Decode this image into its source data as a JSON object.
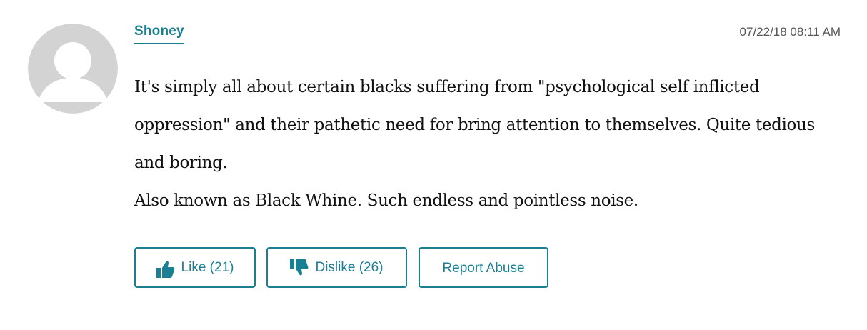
{
  "comment": {
    "author": "Shoney",
    "timestamp": "07/22/18 08:11 AM",
    "paragraphs": [
      "It's simply all about certain blacks suffering from \"psychological self inflicted oppression\" and their pathetic need for bring attention to themselves. Quite tedious and boring.",
      "Also known as Black Whine. Such endless and pointless noise."
    ]
  },
  "actions": {
    "like_label": "Like",
    "like_count": "(21)",
    "dislike_label": "Dislike",
    "dislike_count": "(26)",
    "report_label": "Report Abuse"
  },
  "icons": {
    "avatar": "default-user-avatar-icon",
    "like": "thumbs-up-icon",
    "dislike": "thumbs-down-icon"
  },
  "colors": {
    "accent": "#1a7f92",
    "avatar": "#d3d3d3",
    "body_text": "#111111",
    "timestamp": "#555555"
  }
}
